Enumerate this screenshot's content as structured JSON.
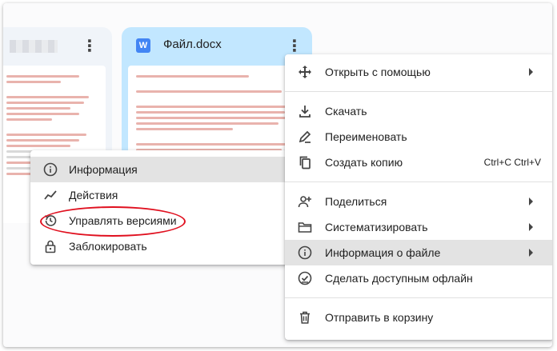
{
  "cards": {
    "right": {
      "file_name": "Файл.docx",
      "file_type_icon": "W"
    }
  },
  "main_menu": {
    "items": [
      {
        "icon": "move-arrows-icon",
        "label": "Открыть с помощью",
        "has_submenu": true
      },
      {
        "icon": "download-icon",
        "label": "Скачать"
      },
      {
        "icon": "pencil-icon",
        "label": "Переименовать"
      },
      {
        "icon": "copy-icon",
        "label": "Создать копию",
        "shortcut": "Ctrl+C Ctrl+V"
      },
      {
        "icon": "person-add-icon",
        "label": "Поделиться",
        "has_submenu": true
      },
      {
        "icon": "folder-icon",
        "label": "Систематизировать",
        "has_submenu": true
      },
      {
        "icon": "info-icon",
        "label": "Информация о файле",
        "has_submenu": true,
        "highlighted": true
      },
      {
        "icon": "offline-check-icon",
        "label": "Сделать доступным офлайн"
      },
      {
        "icon": "trash-icon",
        "label": "Отправить в корзину"
      }
    ]
  },
  "sub_menu": {
    "items": [
      {
        "icon": "info-icon",
        "label": "Информация",
        "highlighted": true
      },
      {
        "icon": "activity-icon",
        "label": "Действия"
      },
      {
        "icon": "history-icon",
        "label": "Управлять версиями",
        "annotated": true
      },
      {
        "icon": "lock-icon",
        "label": "Заблокировать"
      }
    ]
  },
  "colors": {
    "selected_card": "#c2e7ff",
    "highlight": "#e3e3e3",
    "annotation": "#e0101f"
  }
}
